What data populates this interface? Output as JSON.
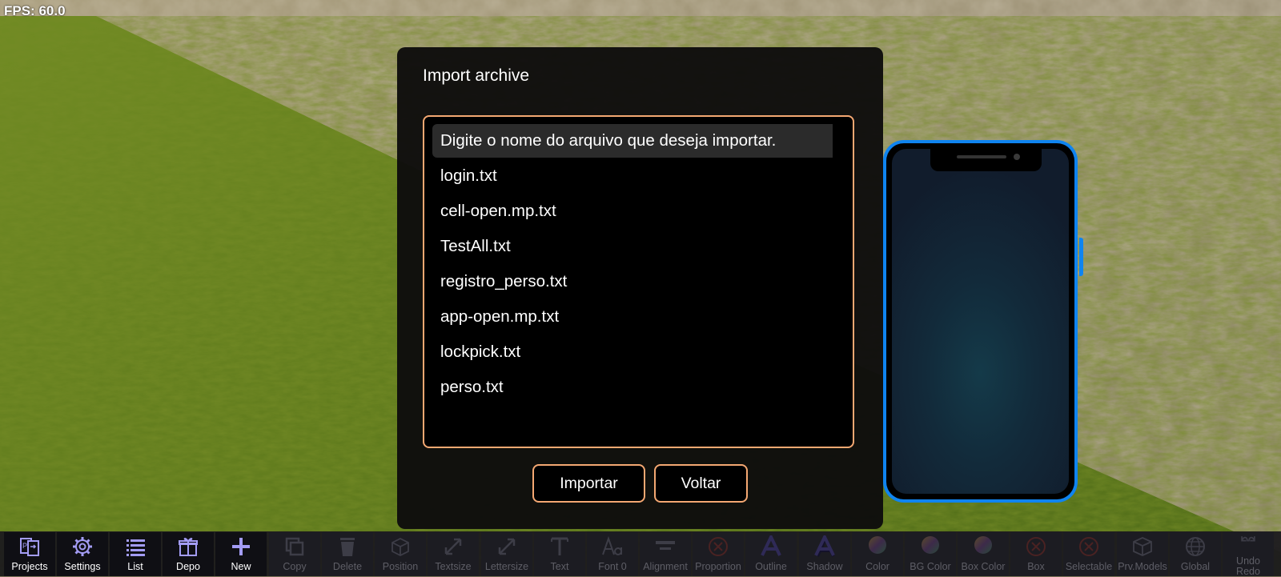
{
  "fps": "FPS: 60.0",
  "dialog": {
    "title": "Import archive",
    "files": [
      "Digite o nome do arquivo que deseja importar.",
      "login.txt",
      "cell-open.mp.txt",
      "TestAll.txt",
      "registro_perso.txt",
      "app-open.mp.txt",
      "lockpick.txt",
      "perso.txt"
    ],
    "import_label": "Importar",
    "back_label": "Voltar"
  },
  "toolbar": {
    "items": [
      {
        "label": "Projects",
        "icon": "projects-icon",
        "enabled": true
      },
      {
        "label": "Settings",
        "icon": "gear-icon",
        "enabled": true
      },
      {
        "label": "List",
        "icon": "list-icon",
        "enabled": true
      },
      {
        "label": "Depo",
        "icon": "gift-icon",
        "enabled": true
      },
      {
        "label": "New",
        "icon": "plus-icon",
        "enabled": true
      },
      {
        "label": "Copy",
        "icon": "copy-icon",
        "enabled": false
      },
      {
        "label": "Delete",
        "icon": "trash-icon",
        "enabled": false
      },
      {
        "label": "Position",
        "icon": "cube-icon",
        "enabled": false
      },
      {
        "label": "Textsize",
        "icon": "resize-icon",
        "enabled": false
      },
      {
        "label": "Lettersize",
        "icon": "resize-icon",
        "enabled": false
      },
      {
        "label": "Text",
        "icon": "text-icon",
        "enabled": false
      },
      {
        "label": "Font 0",
        "icon": "font-icon",
        "enabled": false
      },
      {
        "label": "Alignment",
        "icon": "alignment-icon",
        "enabled": false
      },
      {
        "label": "Proportion",
        "icon": "x-circle-icon",
        "enabled": false
      },
      {
        "label": "Outline",
        "icon": "outline-icon",
        "enabled": false
      },
      {
        "label": "Shadow",
        "icon": "shadow-icon",
        "enabled": false
      },
      {
        "label": "Color",
        "icon": "color-wheel-icon",
        "enabled": false
      },
      {
        "label": "BG Color",
        "icon": "color-wheel-icon",
        "enabled": false
      },
      {
        "label": "Box Color",
        "icon": "color-wheel-icon",
        "enabled": false
      },
      {
        "label": "Box",
        "icon": "x-circle-icon",
        "enabled": false
      },
      {
        "label": "Selectable",
        "icon": "x-circle-icon",
        "enabled": false
      },
      {
        "label": "Prv.Models",
        "icon": "model-cube-icon",
        "enabled": false
      },
      {
        "label": "Global",
        "icon": "globe-icon",
        "enabled": false
      },
      {
        "label": "Undo\nRedo",
        "icon": "undo-redo-icon",
        "enabled": false
      }
    ]
  },
  "colors": {
    "accent_border": "#f4a872",
    "phone_frame": "#0f84f0",
    "icon_active": "#a39cf4",
    "icon_disabled": "#3d3d47"
  }
}
